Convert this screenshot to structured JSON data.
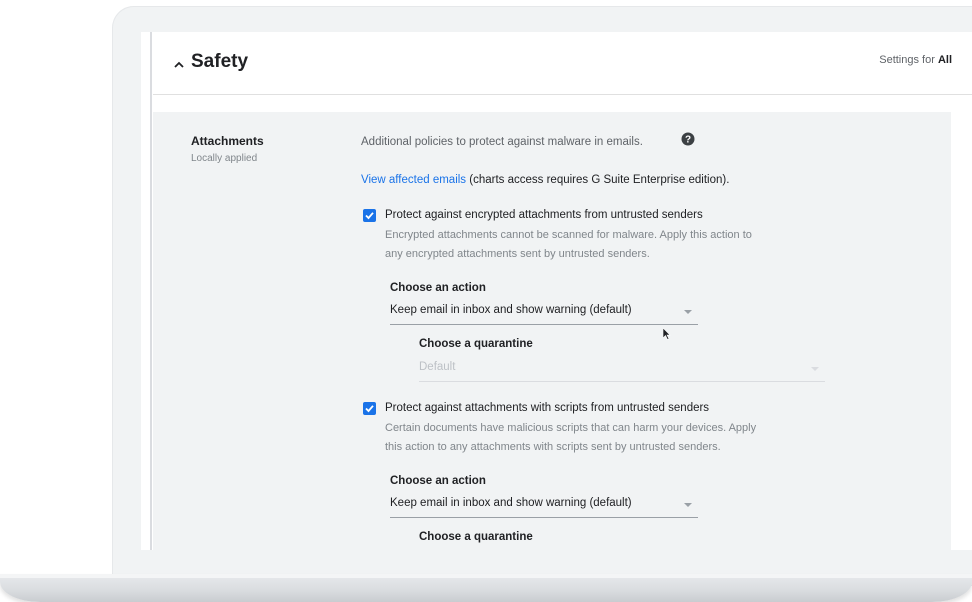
{
  "header": {
    "title": "Safety",
    "settings_prefix": "Settings for",
    "settings_scope": "All"
  },
  "setting": {
    "name": "Attachments",
    "sub": "Locally applied",
    "description": "Additional policies to protect against malware in emails.",
    "view_link": "View affected emails",
    "view_note": "(charts access requires G Suite Enterprise edition)."
  },
  "options": [
    {
      "checked": true,
      "title": "Protect against encrypted attachments from untrusted senders",
      "desc_line1": "Encrypted attachments cannot be scanned for malware. Apply this action to",
      "desc_line2": "any encrypted attachments sent by untrusted senders.",
      "action_label": "Choose an action",
      "action_value": "Keep email in inbox and show warning (default)",
      "quarantine_label": "Choose a quarantine",
      "quarantine_value": "Default"
    },
    {
      "checked": true,
      "title": "Protect against attachments with scripts from untrusted senders",
      "desc_line1": "Certain documents have malicious scripts that can harm your devices. Apply",
      "desc_line2": "this action to any attachments with scripts sent by untrusted senders.",
      "action_label": "Choose an action",
      "action_value": "Keep email in inbox and show warning (default)",
      "quarantine_label": "Choose a quarantine"
    }
  ],
  "icons": {
    "collapse": "chevron-up-icon",
    "help": "help-circle-icon",
    "checkbox": "check-icon"
  },
  "colors": {
    "accent": "#1a73e8",
    "panel": "#f1f3f4"
  }
}
